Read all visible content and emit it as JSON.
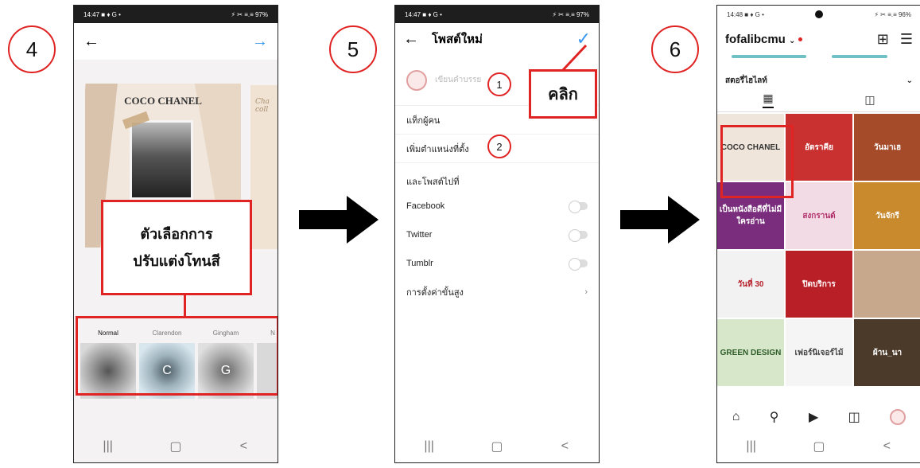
{
  "steps": [
    "4",
    "5",
    "6"
  ],
  "phone1": {
    "time": "14:47",
    "status_left_icons": "■ ♦ G •",
    "status_right": "⚡ ✂ ≡.≡ 97%",
    "back_icon": "arrow-left",
    "next_icon": "arrow-right",
    "poster_title": "COCO CHANEL",
    "side_poster_text": "Cha coll",
    "filters": [
      {
        "name": "Normal",
        "letter": ""
      },
      {
        "name": "Clarendon",
        "letter": "C"
      },
      {
        "name": "Gingham",
        "letter": "G"
      }
    ],
    "callout_line1": "ตัวเลือกการ",
    "callout_line2": "ปรับแต่งโทนสี",
    "nav": [
      "|||",
      "▢",
      "<"
    ]
  },
  "phone2": {
    "time": "14:47",
    "status_left_icons": "■ ♦ G •",
    "status_right": "⚡ ✂ ≡.≡ 97%",
    "title": "โพสต์ใหม่",
    "caption_placeholder": "เขียนคำบรรย",
    "tag_people": "แท็กผู้คน",
    "add_location": "เพิ่มตำแหน่งที่ตั้ง",
    "also_post_to": "และโพสต์ไปที่",
    "facebook": "Facebook",
    "twitter": "Twitter",
    "tumblr": "Tumblr",
    "advanced": "การตั้งค่าขั้นสูง",
    "badge1": "1",
    "badge2": "2",
    "click_label": "คลิก",
    "nav": [
      "|||",
      "▢",
      "<"
    ]
  },
  "phone3": {
    "time": "14:48",
    "status_left_icons": "■ ♦ G •",
    "status_right": "⚡ ✂ ≡.≡ 96%",
    "username": "fofalibcmu",
    "highlights": "สตอรี่ไฮไลท์",
    "grid": [
      {
        "text": "COCO CHANEL",
        "bg": "#efe5da",
        "fg": "#333"
      },
      {
        "text": "อัตราคีย",
        "bg": "#c8312f",
        "fg": "#fff"
      },
      {
        "text": "วันมาเฮ",
        "bg": "#a64b2a",
        "fg": "#fff"
      },
      {
        "text": "เป็นหนังสือดีที่ไม่มีใครอ่าน",
        "bg": "#7a2d7d",
        "fg": "#fff"
      },
      {
        "text": "สงกรานต์",
        "bg": "#f3dbe6",
        "fg": "#b1306a"
      },
      {
        "text": "วันจักรี",
        "bg": "#c98a2e",
        "fg": "#fff"
      },
      {
        "text": "วันที่ 30",
        "bg": "#f2f2f2",
        "fg": "#b7212b"
      },
      {
        "text": "ปิดบริการ",
        "bg": "#b81f26",
        "fg": "#fff"
      },
      {
        "text": "",
        "bg": "#c7a88c",
        "fg": "#fff"
      },
      {
        "text": "GREEN DESIGN",
        "bg": "#d6e8c9",
        "fg": "#2e5b2a"
      },
      {
        "text": "เฟอร์นิเจอร์ไม้",
        "bg": "#f5f5f5",
        "fg": "#444"
      },
      {
        "text": "ผ้าน_นา",
        "bg": "#4b3a2a",
        "fg": "#fff"
      }
    ],
    "nav": [
      "|||",
      "▢",
      "<"
    ]
  },
  "colors": {
    "accent_red": "#e02424",
    "ig_blue": "#3897f0"
  }
}
